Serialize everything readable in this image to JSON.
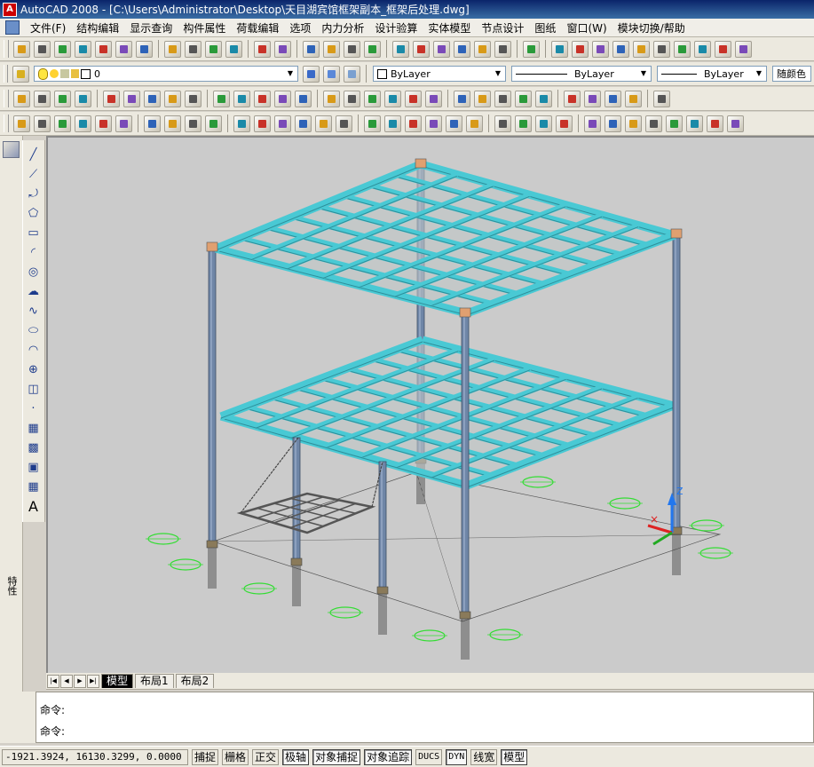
{
  "app": {
    "title": "AutoCAD 2008 - [C:\\Users\\Administrator\\Desktop\\天目湖宾馆框架副本_框架后处理.dwg]"
  },
  "menu": {
    "items": [
      "文件(F)",
      "结构编辑",
      "显示查询",
      "构件属性",
      "荷载编辑",
      "选项",
      "内力分析",
      "设计验算",
      "实体模型",
      "节点设计",
      "图纸",
      "窗口(W)",
      "模块切换/帮助"
    ]
  },
  "layer_toolbar": {
    "layer_value": "0",
    "color_value": "ByLayer",
    "linetype_value": "ByLayer",
    "lineweight_value": "ByLayer",
    "plotstyle_value": "随颜色"
  },
  "icons": {
    "toolbar1": [
      "new-icon",
      "open-icon",
      "save-icon",
      "print-icon",
      "preview-icon",
      "publish-icon",
      "3d-dwf-icon",
      "cut-icon",
      "copy-icon",
      "paste-icon",
      "match-properties-icon",
      "undo-icon",
      "redo-icon",
      "pan-icon",
      "zoom-realtime-icon",
      "zoom-window-icon",
      "zoom-previous-icon",
      "properties-icon",
      "design-center-icon",
      "tool-palettes-icon",
      "sheet-set-icon",
      "markup-icon",
      "calculator-icon",
      "help-icon",
      "ucs-icon",
      "view-front-icon",
      "view-left-icon",
      "view-right-icon",
      "view-back-icon",
      "view-top-icon",
      "view-iso-sw-icon",
      "view-iso-se-icon",
      "view-iso-ne-icon",
      "view-iso-nw-icon"
    ],
    "toolbar3": [
      "grid-axis-icon",
      "grid-plan-icon",
      "column-icon",
      "beam-icon",
      "brace-icon",
      "slab-icon",
      "bracket-icon",
      "section-icon",
      "wall-icon",
      "truss-icon",
      "frame-icon",
      "load-icon",
      "node-icon",
      "release-icon",
      "check-icon",
      "analyze-icon",
      "result-icon",
      "design-icon",
      "report-icon",
      "detail-icon",
      "connection-icon",
      "joint-icon",
      "plate-icon",
      "bolt-icon",
      "weld-icon",
      "delete-red-icon",
      "add-red-icon",
      "blue-box-icon",
      "list-icon",
      "section-i-icon"
    ],
    "toolbar4": [
      "member-list-icon",
      "base-plate-icon",
      "stiffener-icon",
      "purlin-icon",
      "wall-beam-icon",
      "sag-rod-icon",
      "cross-brace-icon",
      "tie-icon",
      "roof-icon",
      "clip-icon",
      "angle-icon",
      "gusset-icon",
      "end-plate-icon",
      "splice-icon",
      "haunch-icon",
      "cap-plate-icon",
      "shop-drawing-icon",
      "material-table-icon",
      "mark-icon",
      "layout-icon",
      "dimension-icon",
      "annotate-icon",
      "quantity-icon",
      "export-icon",
      "print-drawing-icon",
      "calc-book-icon",
      "roof-panel-icon",
      "max-icon",
      "layer-icon",
      "flip-icon",
      "z-section-icon",
      "tree-icon",
      "cut-line-icon",
      "slope-icon"
    ],
    "draw": [
      "line-icon",
      "construction-line-icon",
      "polyline-icon",
      "polygon-icon",
      "rectangle-icon",
      "arc-icon",
      "circle-icon",
      "revision-cloud-icon",
      "spline-icon",
      "ellipse-icon",
      "ellipse-arc-icon",
      "insert-block-icon",
      "make-block-icon",
      "point-icon",
      "hatch-icon",
      "gradient-icon",
      "region-icon",
      "table-icon",
      "multiline-text-icon"
    ]
  },
  "colors": {
    "beam": "#49c9d4",
    "column": "#6f86a7",
    "viewport": "#cbcbcb",
    "pile_marker": "#33dd33",
    "ucs_y": "#2277ee",
    "ucs_x": "#dd2222"
  },
  "layout_tabs": [
    "模型",
    "布局1",
    "布局2"
  ],
  "command": {
    "line1": "命令:",
    "line2": "命令:"
  },
  "status": {
    "coords": "-1921.3924, 16130.3299, 0.0000",
    "buttons": [
      "捕捉",
      "栅格",
      "正交",
      "极轴",
      "对象捕捉",
      "对象追踪",
      "DUCS",
      "DYN",
      "线宽",
      "模型"
    ]
  },
  "left_dock": {
    "properties_label": "特性"
  },
  "ucs": {
    "z_label": "Z"
  }
}
